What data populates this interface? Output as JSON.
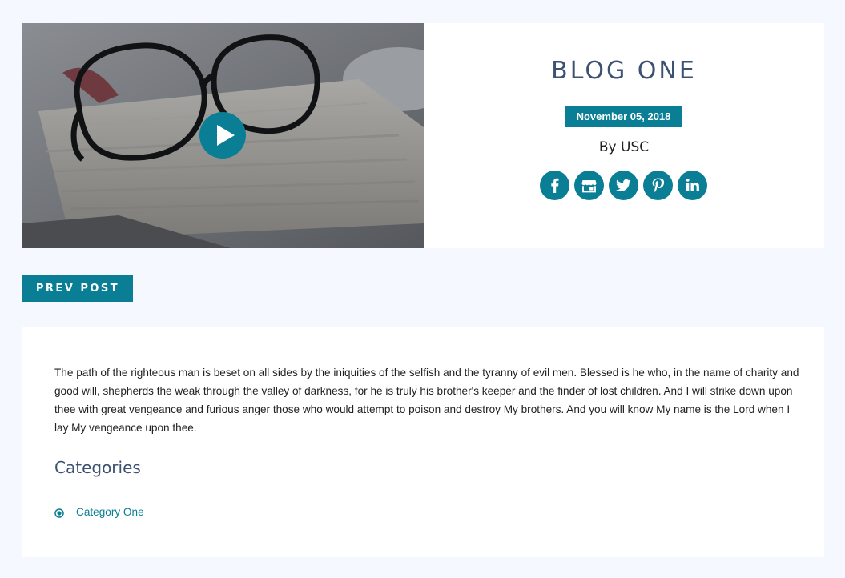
{
  "post": {
    "title": "BLOG ONE",
    "date": "November 05, 2018",
    "author": "By USC"
  },
  "media": {
    "play_icon": "play-icon"
  },
  "social": [
    {
      "name": "facebook-icon"
    },
    {
      "name": "store-icon"
    },
    {
      "name": "twitter-icon"
    },
    {
      "name": "pinterest-icon"
    },
    {
      "name": "linkedin-icon"
    }
  ],
  "nav": {
    "prev_label": "PREV POST"
  },
  "content": {
    "body": "The path of the righteous man is beset on all sides by the iniquities of the selfish and the tyranny of evil men. Blessed is he who, in the name of charity and good will, shepherds the weak through the valley of darkness, for he is truly his brother's keeper and the finder of lost children. And I will strike down upon thee with great vengeance and furious anger those who would attempt to poison and destroy My brothers. And you will know My name is the Lord when I lay My vengeance upon thee."
  },
  "categories": {
    "heading": "Categories",
    "items": [
      {
        "label": "Category One",
        "selected": true
      }
    ]
  },
  "colors": {
    "accent": "#0a7e94",
    "heading": "#3d5272",
    "page_bg": "#f5f8fe"
  }
}
